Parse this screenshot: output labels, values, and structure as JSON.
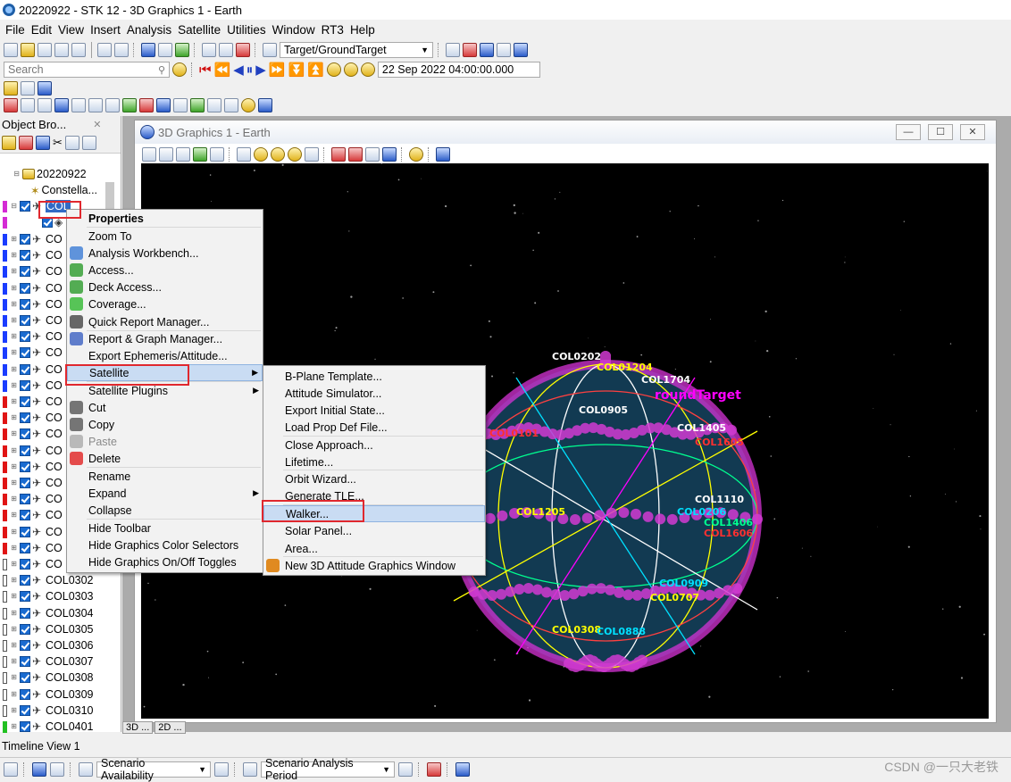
{
  "window": {
    "title": "20220922 - STK 12 - 3D Graphics 1 - Earth"
  },
  "menubar": [
    "File",
    "Edit",
    "View",
    "Insert",
    "Analysis",
    "Satellite",
    "Utilities",
    "Window",
    "RT3",
    "Help"
  ],
  "toolbar": {
    "target_combo": "Target/GroundTarget",
    "search_placeholder": "Search",
    "datetime": "22 Sep 2022 04:00:00.000"
  },
  "browser": {
    "title": "Object Bro...",
    "scenario": "20220922",
    "constellation": "Constella...",
    "selected_item": "COL",
    "items": [
      {
        "label": "CO",
        "color": "#1a3cff"
      },
      {
        "label": "CO",
        "color": "#1a3cff"
      },
      {
        "label": "CO",
        "color": "#1a3cff"
      },
      {
        "label": "CO",
        "color": "#1a3cff"
      },
      {
        "label": "CO",
        "color": "#1a3cff"
      },
      {
        "label": "CO",
        "color": "#1a3cff"
      },
      {
        "label": "CO",
        "color": "#1a3cff"
      },
      {
        "label": "CO",
        "color": "#1a3cff"
      },
      {
        "label": "CO",
        "color": "#1a3cff"
      },
      {
        "label": "CO",
        "color": "#1a3cff"
      },
      {
        "label": "CO",
        "color": "#e01414"
      },
      {
        "label": "CO",
        "color": "#e01414"
      },
      {
        "label": "CO",
        "color": "#e01414"
      },
      {
        "label": "CO",
        "color": "#e01414"
      },
      {
        "label": "CO",
        "color": "#e01414"
      },
      {
        "label": "CO",
        "color": "#e01414"
      },
      {
        "label": "CO",
        "color": "#e01414"
      },
      {
        "label": "CO",
        "color": "#e01414"
      },
      {
        "label": "CO",
        "color": "#e01414"
      },
      {
        "label": "CO",
        "color": "#e01414"
      },
      {
        "label": "CO",
        "color": "#ffffff"
      },
      {
        "label": "COL0302",
        "color": "#ffffff"
      },
      {
        "label": "COL0303",
        "color": "#ffffff"
      },
      {
        "label": "COL0304",
        "color": "#ffffff"
      },
      {
        "label": "COL0305",
        "color": "#ffffff"
      },
      {
        "label": "COL0306",
        "color": "#ffffff"
      },
      {
        "label": "COL0307",
        "color": "#ffffff"
      },
      {
        "label": "COL0308",
        "color": "#ffffff"
      },
      {
        "label": "COL0309",
        "color": "#ffffff"
      },
      {
        "label": "COL0310",
        "color": "#ffffff"
      },
      {
        "label": "COL0401",
        "color": "#22c022"
      }
    ]
  },
  "graphics_window": {
    "title": "3D Graphics 1 - Earth"
  },
  "context_menu": {
    "items": [
      "Properties",
      "Zoom To",
      "Analysis Workbench...",
      "Access...",
      "Deck Access...",
      "Coverage...",
      "Quick Report Manager...",
      "Report & Graph Manager...",
      "Export Ephemeris/Attitude...",
      "Satellite",
      "Satellite Plugins",
      "Cut",
      "Copy",
      "Paste",
      "Delete",
      "Rename",
      "Expand",
      "Collapse",
      "Hide Toolbar",
      "Hide Graphics Color Selectors",
      "Hide Graphics On/Off Toggles"
    ]
  },
  "satellite_submenu": {
    "items": [
      "B-Plane Template...",
      "Attitude Simulator...",
      "Export Initial State...",
      "Load Prop Def File...",
      "Close Approach...",
      "Lifetime...",
      "Orbit Wizard...",
      "Generate TLE...",
      "Walker...",
      "Solar Panel...",
      "Area...",
      "New 3D Attitude Graphics Window"
    ]
  },
  "globe_labels": [
    "COL0202",
    "COL01204",
    "COL1704",
    "roundTarget",
    "COL0905",
    "COL1405",
    "COL1605",
    "COL1110",
    "COL0206",
    "COL1406",
    "COL1606",
    "COL0909",
    "COL0707",
    "COL0308",
    "COL0888",
    "COL0101",
    "COL1205"
  ],
  "view_tabs": [
    "3D ...",
    "2D ..."
  ],
  "timeline": {
    "title": "Timeline View 1",
    "availability": "Scenario Availability",
    "analysis_period": "Scenario Analysis Period"
  },
  "watermark": "CSDN @一只大老铁"
}
